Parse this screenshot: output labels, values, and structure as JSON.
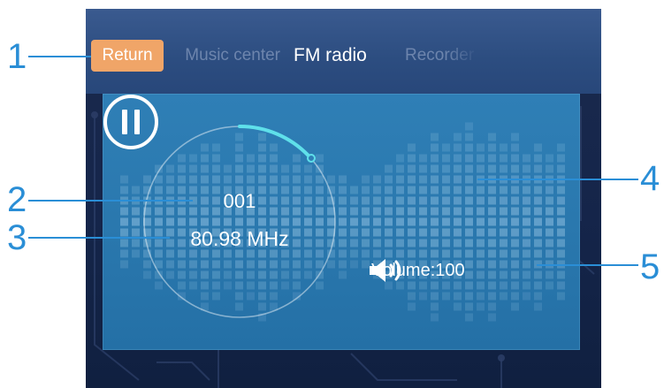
{
  "header": {
    "return_label": "Return",
    "tabs": [
      {
        "label": "Music center",
        "state": "partially-hidden"
      },
      {
        "label": "FM radio",
        "state": "active"
      },
      {
        "label": "Recorder",
        "state": "partially-hidden"
      }
    ]
  },
  "player": {
    "channel": "001",
    "frequency": "80.98 MHz",
    "volume_text": "Volume:100",
    "play_state": "playing"
  },
  "callouts": [
    "1",
    "2",
    "3",
    "4",
    "5"
  ],
  "icons": {
    "pause": "pause-icon",
    "volume": "speaker-icon"
  },
  "colors": {
    "accent_orange": "#f0a568",
    "callout_blue": "#2a8ed6",
    "panel_blue": "#2f7fb6",
    "dial_arc": "#5fe0ea"
  }
}
